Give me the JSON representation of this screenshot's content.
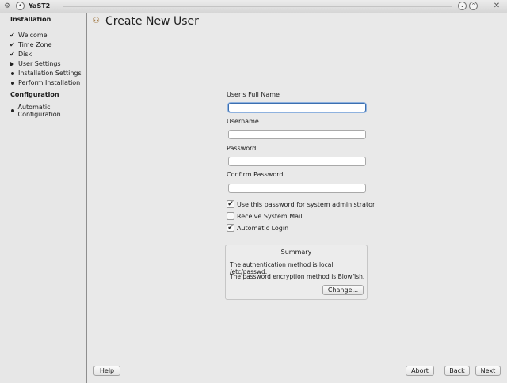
{
  "window": {
    "title": "YaST2"
  },
  "sidebar": {
    "installation_header": "Installation",
    "installation_steps": [
      {
        "label": "Welcome",
        "state": "done"
      },
      {
        "label": "Time Zone",
        "state": "done"
      },
      {
        "label": "Disk",
        "state": "done"
      },
      {
        "label": "User Settings",
        "state": "current"
      },
      {
        "label": "Installation Settings",
        "state": "pending"
      },
      {
        "label": "Perform Installation",
        "state": "pending"
      }
    ],
    "configuration_header": "Configuration",
    "configuration_steps": [
      {
        "label": "Automatic Configuration",
        "state": "pending"
      }
    ]
  },
  "main": {
    "title": "Create New User",
    "fields": {
      "full_name": {
        "label": "User's Full Name",
        "value": ""
      },
      "username": {
        "label": "Username",
        "value": ""
      },
      "password": {
        "label": "Password",
        "value": ""
      },
      "confirm_password": {
        "label": "Confirm Password",
        "value": ""
      }
    },
    "checkboxes": [
      {
        "label": "Use this password for system administrator",
        "checked": true
      },
      {
        "label": "Receive System Mail",
        "checked": false
      },
      {
        "label": "Automatic Login",
        "checked": true
      }
    ],
    "summary": {
      "title": "Summary",
      "line1": "The authentication method is local /etc/passwd.",
      "line2": "The password encryption method is Blowfish.",
      "change_label": "Change..."
    }
  },
  "buttons": {
    "help": "Help",
    "abort": "Abort",
    "back": "Back",
    "next": "Next"
  },
  "icons": {
    "check": "✔",
    "pending": "dot",
    "current": "arrow"
  }
}
